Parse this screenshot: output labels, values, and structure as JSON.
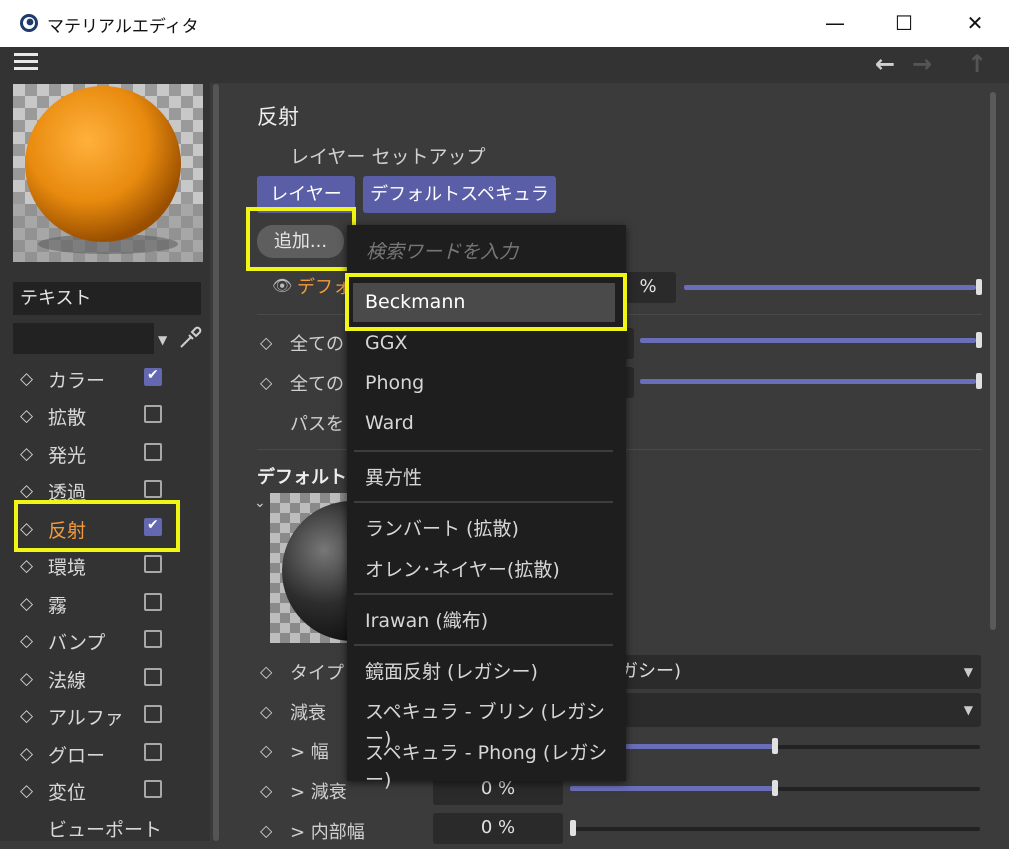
{
  "window": {
    "title": "マテリアルエディタ",
    "minimize": "—",
    "maximize": "☐",
    "close": "✕"
  },
  "toolbar": {
    "back": "←",
    "forward": "→",
    "up": "↑"
  },
  "material_name": "テキスト",
  "channels": [
    {
      "label": "カラー",
      "checked": true
    },
    {
      "label": "拡散",
      "checked": false
    },
    {
      "label": "発光",
      "checked": false
    },
    {
      "label": "透過",
      "checked": false
    },
    {
      "label": "反射",
      "checked": true
    },
    {
      "label": "環境",
      "checked": false
    },
    {
      "label": "霧",
      "checked": false
    },
    {
      "label": "バンプ",
      "checked": false
    },
    {
      "label": "法線",
      "checked": false
    },
    {
      "label": "アルファ",
      "checked": false
    },
    {
      "label": "グロー",
      "checked": false
    },
    {
      "label": "変位",
      "checked": false
    },
    {
      "label": "ビューポート",
      "checked": null
    }
  ],
  "reflection": {
    "title": "反射",
    "layer_setup": "レイヤー セットアップ",
    "tab_layer": "レイヤー",
    "tab_default_specular": "デフォルトスペキュラ",
    "add_button": "追加...",
    "default_row_label": "デフォル",
    "default_row_unit": "%",
    "all_row_1": "全ての",
    "all_row_2": "全ての",
    "pass_row": "パスを",
    "default_section_title": "デフォルトス",
    "collapse": "⌄"
  },
  "properties": [
    {
      "label": "タイプ",
      "value": "ガシー)"
    },
    {
      "label": "減衰",
      "value": ""
    },
    {
      "label": "> 幅",
      "value": ""
    },
    {
      "label": "> 減衰",
      "value": "0 %"
    },
    {
      "label": "> 内部幅",
      "value": "0 %"
    }
  ],
  "add_menu": {
    "search_placeholder": "検索ワードを入力",
    "items": [
      "Beckmann",
      "GGX",
      "Phong",
      "Ward",
      "異方性",
      "ランバート (拡散)",
      "オレン･ネイヤー(拡散)",
      "Irawan (織布)",
      "鏡面反射 (レガシー)",
      "スペキュラ - ブリン (レガシー)",
      "スペキュラ - Phong (レガシー)"
    ],
    "selected_index": 0
  },
  "colors": {
    "accent": "#5a5ea7",
    "active_label": "#f29b3c",
    "highlight": "#f0f515",
    "panel": "#333333",
    "menu_bg": "#1e1e1e"
  }
}
